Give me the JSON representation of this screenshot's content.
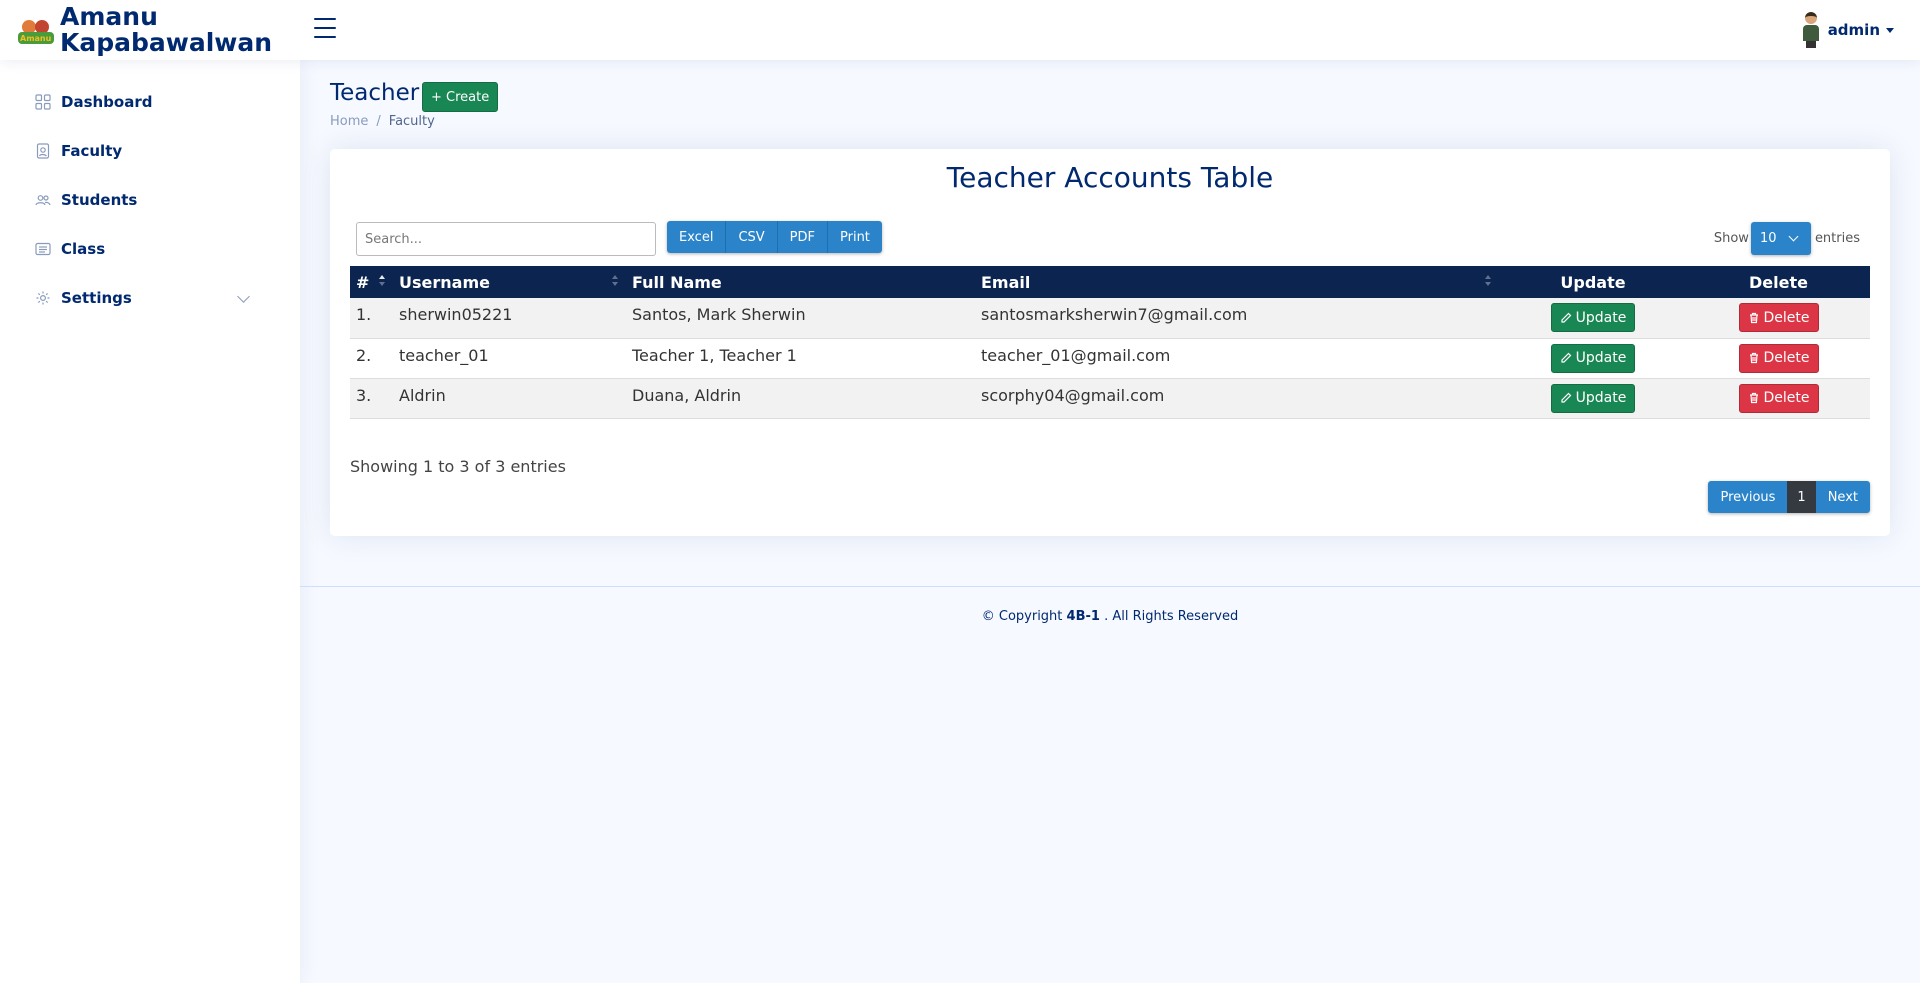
{
  "brand": {
    "line1": "Amanu",
    "line2": "Kapabawalwan",
    "logo_text": "Amanu"
  },
  "header": {
    "user": "admin"
  },
  "sidebar": {
    "items": [
      {
        "label": "Dashboard",
        "icon": "grid-icon"
      },
      {
        "label": "Faculty",
        "icon": "person-badge-icon"
      },
      {
        "label": "Students",
        "icon": "people-icon"
      },
      {
        "label": "Class",
        "icon": "card-list-icon"
      },
      {
        "label": "Settings",
        "icon": "gear-icon"
      }
    ]
  },
  "page": {
    "title": "Teacher",
    "create_label": "+ Create",
    "breadcrumb": [
      "Home",
      "Faculty"
    ]
  },
  "card": {
    "title": "Teacher Accounts Table",
    "search_placeholder": "Search...",
    "export_buttons": [
      "Excel",
      "CSV",
      "PDF",
      "Print"
    ],
    "length": {
      "show": "Show",
      "value": "10",
      "entries": "entries"
    },
    "columns": [
      "#",
      "Username",
      "Full Name",
      "Email",
      "Update",
      "Delete"
    ],
    "rows": [
      {
        "num": "1.",
        "username": "sherwin05221",
        "fullname": "Santos, Mark Sherwin",
        "email": "santosmarksherwin7@gmail.com"
      },
      {
        "num": "2.",
        "username": "teacher_01",
        "fullname": "Teacher 1, Teacher 1",
        "email": "teacher_01@gmail.com"
      },
      {
        "num": "3.",
        "username": "Aldrin",
        "fullname": "Duana, Aldrin",
        "email": "scorphy04@gmail.com"
      }
    ],
    "update_label": "Update",
    "delete_label": "Delete",
    "info": "Showing 1 to 3 of 3 entries",
    "pager": {
      "prev": "Previous",
      "page": "1",
      "next": "Next"
    }
  },
  "footer": {
    "prefix": "© Copyright",
    "strong": "4B-1",
    "suffix": ". All Rights Reserved"
  },
  "colors": {
    "primary": "#012970",
    "table_header": "#0b2550",
    "success": "#198754",
    "danger": "#dc3545",
    "info": "#2b84c9"
  }
}
